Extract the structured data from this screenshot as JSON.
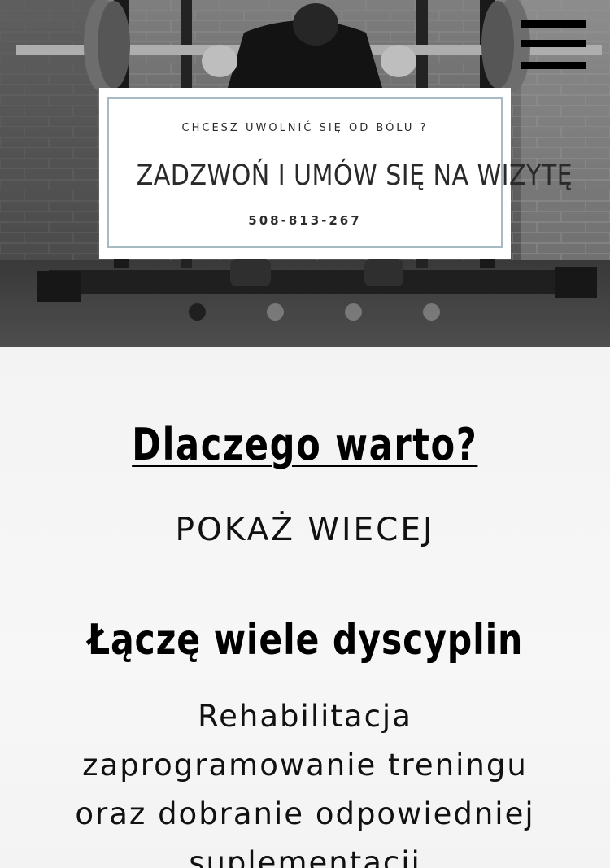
{
  "hero": {
    "promo": {
      "kicker": "CHCESZ UWOLNIĆ SIĘ OD BÓLU ?",
      "headline": "ZADZWOŃ I UMÓW SIĘ NA WIZYTĘ",
      "phone": "508-813-267"
    },
    "slider": {
      "slide_count": 4,
      "active_index": 0
    }
  },
  "menu": {
    "icon": "hamburger-menu-icon"
  },
  "main": {
    "heading": "Dlaczego warto?",
    "show_more_label": "POKAŻ WIECEJ",
    "subheading": "Łączę wiele dyscyplin",
    "description_lines": [
      "Rehabilitacja",
      "zaprogramowanie treningu",
      "oraz dobranie odpowiedniej",
      "suplementacji"
    ]
  },
  "colors": {
    "card_border": "#a7bac4",
    "dot_active": "#1f1f1f",
    "text_dark": "#111111"
  }
}
